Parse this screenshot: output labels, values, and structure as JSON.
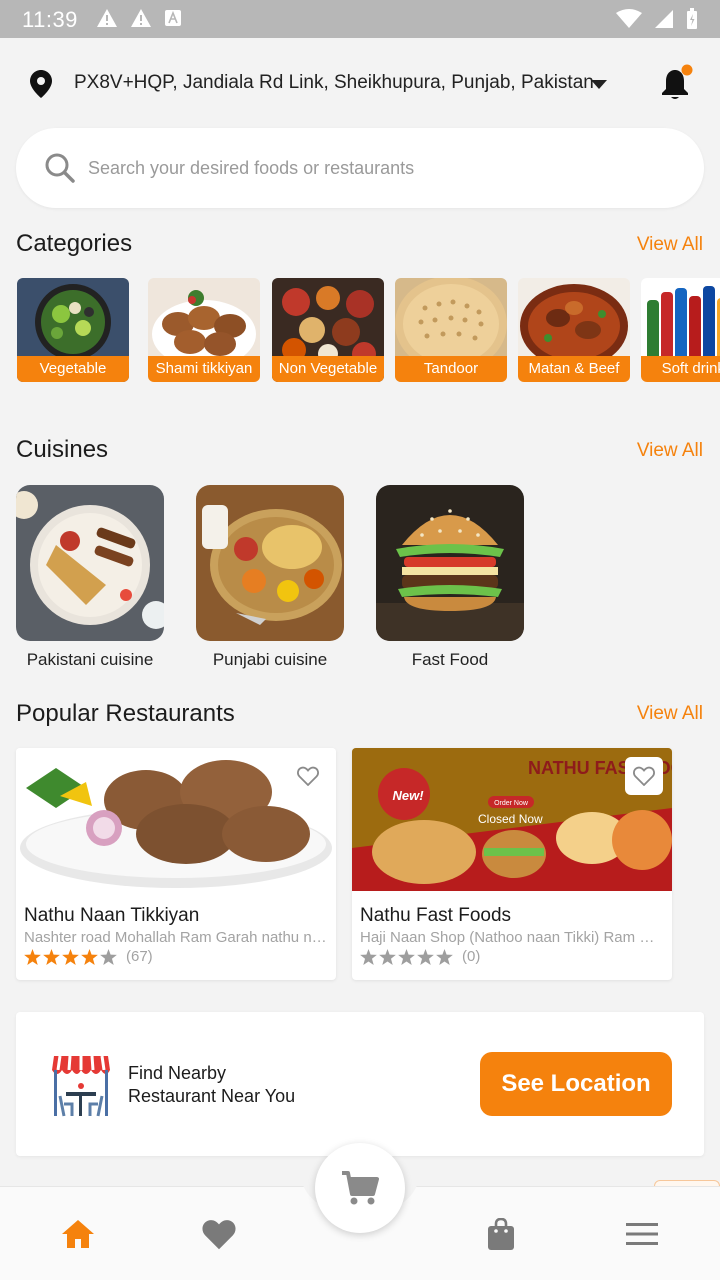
{
  "status_bar": {
    "time": "11:39"
  },
  "location": {
    "address": "PX8V+HQP, Jandiala Rd Link, Sheikhupura, Punjab, Pakistan"
  },
  "search": {
    "placeholder": "Search your desired foods or restaurants"
  },
  "categories": {
    "title": "Categories",
    "view_all": "View All",
    "items": [
      {
        "label": "Vegetable"
      },
      {
        "label": "Shami tikkiyan"
      },
      {
        "label": "Non Vegetable"
      },
      {
        "label": "Tandoor"
      },
      {
        "label": "Matan & Beef"
      },
      {
        "label": "Soft drinks"
      }
    ]
  },
  "cuisines": {
    "title": "Cuisines",
    "view_all": "View All",
    "items": [
      {
        "label": "Pakistani cuisine"
      },
      {
        "label": "Punjabi cuisine"
      },
      {
        "label": "Fast Food"
      }
    ]
  },
  "restaurants": {
    "title": "Popular Restaurants",
    "view_all": "View All",
    "items": [
      {
        "name": "Nathu Naan Tikkiyan",
        "address": "Nashter road Mohallah Ram Garah nathu naan tikki",
        "rating": 4,
        "rating_count": "(67)",
        "status": ""
      },
      {
        "name": "Nathu Fast Foods",
        "address": "Haji Naan Shop (Nathoo naan Tikki) Ram Garah",
        "rating": 0,
        "rating_count": "(0)",
        "status": "Closed Now",
        "banner_text": "NATHU FAST FOODS",
        "promo_text": "New!",
        "order_text": "Order Now"
      }
    ]
  },
  "nearby": {
    "line1": "Find Nearby",
    "line2": "Restaurant Near You",
    "button": "See Location"
  },
  "colors": {
    "accent": "#f5820d",
    "star_inactive": "#9e9e9e",
    "icon_grey": "#7a7a7a"
  },
  "bottom_nav": [
    "home-icon",
    "heart-icon",
    "cart-icon",
    "bag-icon",
    "menu-icon"
  ]
}
